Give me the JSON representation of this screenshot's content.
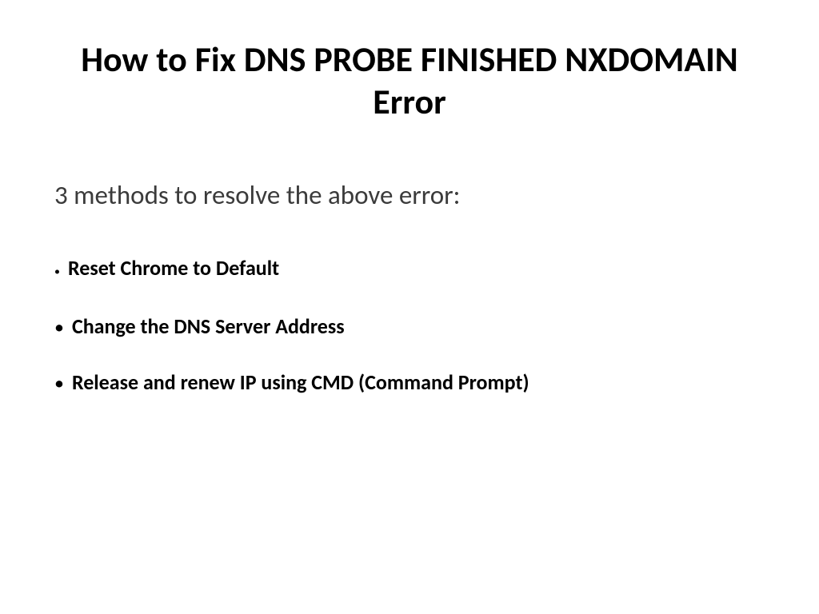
{
  "title": "How to Fix DNS PROBE FINISHED NXDOMAIN Error",
  "subtitle": "3 methods to resolve the above error:",
  "methods": [
    {
      "text": "Reset Chrome to Default",
      "bulletSize": "small"
    },
    {
      "text": "Change the DNS Server Address",
      "bulletSize": "large"
    },
    {
      "text": "Release and renew IP using CMD (Command Prompt)",
      "bulletSize": "large"
    }
  ]
}
